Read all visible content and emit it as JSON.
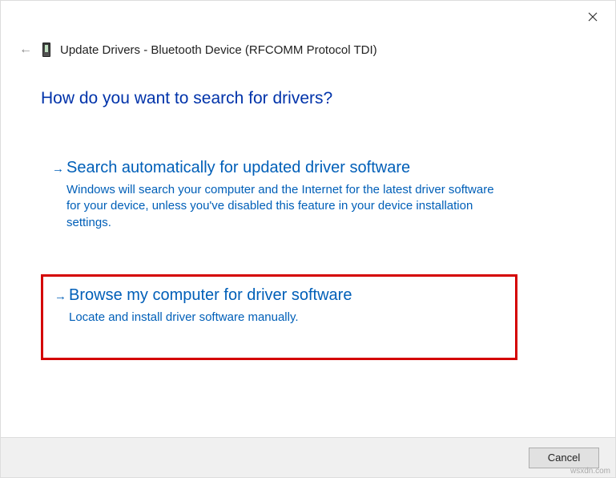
{
  "window": {
    "title": "Update Drivers - Bluetooth Device (RFCOMM Protocol TDI)"
  },
  "heading": "How do you want to search for drivers?",
  "options": [
    {
      "title": "Search automatically for updated driver software",
      "description": "Windows will search your computer and the Internet for the latest driver software for your device, unless you've disabled this feature in your device installation settings."
    },
    {
      "title": "Browse my computer for driver software",
      "description": "Locate and install driver software manually."
    }
  ],
  "buttons": {
    "cancel": "Cancel"
  },
  "watermark": "wsxdn.com"
}
